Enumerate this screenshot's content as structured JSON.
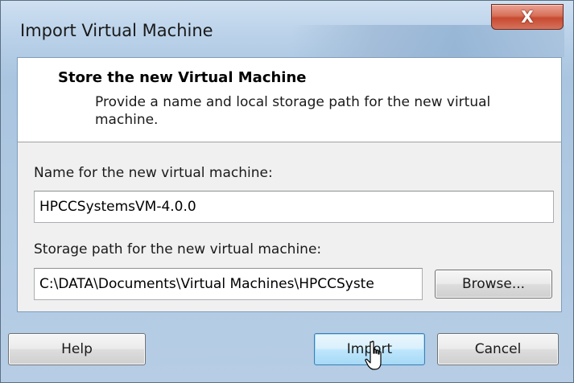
{
  "window": {
    "title": "Import Virtual Machine",
    "close_glyph": "X"
  },
  "header": {
    "title": "Store the new Virtual Machine",
    "description": "Provide a name and local storage path for the new virtual machine."
  },
  "form": {
    "name_label": "Name for the new virtual machine:",
    "name_value": "HPCCSystemsVM-4.0.0",
    "path_label": "Storage path for the new virtual machine:",
    "path_value": "C:\\DATA\\Documents\\Virtual Machines\\HPCCSyste",
    "browse_label": "Browse..."
  },
  "buttons": {
    "help": "Help",
    "import": "Import",
    "cancel": "Cancel"
  },
  "colors": {
    "close_button": "#c74a30",
    "default_button_border": "#3c7fb1"
  },
  "icons": {
    "close": "close-icon",
    "cursor": "hand-pointer-cursor"
  }
}
